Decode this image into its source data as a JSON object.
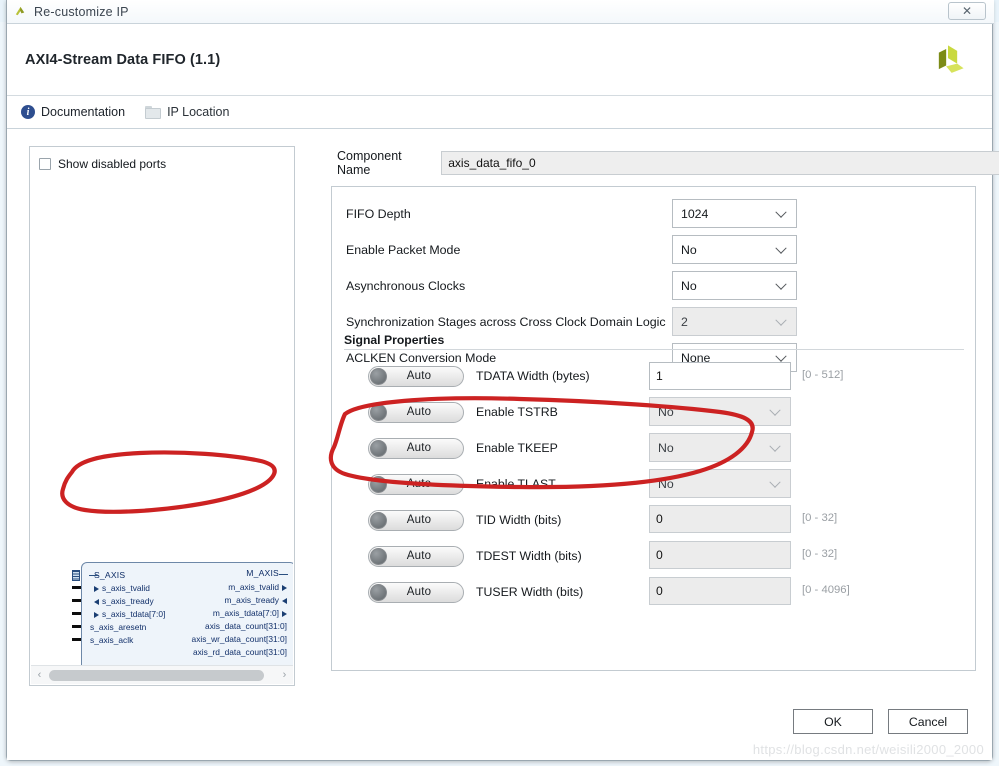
{
  "window": {
    "title": "Re-customize IP",
    "close_label": "✕",
    "app_icon": "xilinx-vivado-icon"
  },
  "header": {
    "ip_title": "AXI4-Stream Data FIFO (1.1)",
    "logo": "xilinx-logo"
  },
  "toolbar": {
    "documentation_label": "Documentation",
    "documentation_icon": "info-icon",
    "ip_location_label": "IP Location",
    "ip_location_icon": "folder-icon"
  },
  "left_panel": {
    "show_disabled_ports_label": "Show disabled ports",
    "show_disabled_ports_checked": false,
    "scroll_left_icon": "‹",
    "scroll_right_icon": "›",
    "diagram": {
      "slave_group": "S_AXIS",
      "master_group": "M_AXIS",
      "slave_signals": [
        {
          "name": "s_axis_tvalid",
          "dir": "in"
        },
        {
          "name": "s_axis_tready",
          "dir": "out"
        },
        {
          "name": "s_axis_tdata[7:0]",
          "dir": "in"
        }
      ],
      "global_signals": [
        "s_axis_aresetn",
        "s_axis_aclk"
      ],
      "master_signals": [
        {
          "name": "m_axis_tvalid",
          "dir": "out"
        },
        {
          "name": "m_axis_tready",
          "dir": "in"
        },
        {
          "name": "m_axis_tdata[7:0]",
          "dir": "out"
        }
      ],
      "count_signals": [
        "axis_data_count[31:0]",
        "axis_wr_data_count[31:0]",
        "axis_rd_data_count[31:0]"
      ]
    }
  },
  "main": {
    "component_name_label": "Component Name",
    "component_name_value": "axis_data_fifo_0",
    "options": [
      {
        "label": "FIFO Depth",
        "value": "1024",
        "disabled": false
      },
      {
        "label": "Enable Packet Mode",
        "value": "No",
        "disabled": false
      },
      {
        "label": "Asynchronous Clocks",
        "value": "No",
        "disabled": false
      },
      {
        "label": "Synchronization Stages across Cross Clock Domain Logic",
        "value": "2",
        "disabled": true
      },
      {
        "label": "ACLKEN Conversion Mode",
        "value": "None",
        "disabled": false
      }
    ],
    "signal_properties": {
      "legend": "Signal Properties",
      "rows": [
        {
          "toggle": "Auto",
          "name": "TDATA Width (bytes)",
          "kind": "text",
          "value": "1",
          "range": "[0 - 512]",
          "disabled": false
        },
        {
          "toggle": "Auto",
          "name": "Enable TSTRB",
          "kind": "select",
          "value": "No",
          "range": "",
          "disabled": true
        },
        {
          "toggle": "Auto",
          "name": "Enable TKEEP",
          "kind": "select",
          "value": "No",
          "range": "",
          "disabled": true
        },
        {
          "toggle": "Auto",
          "name": "Enable TLAST",
          "kind": "select",
          "value": "No",
          "range": "",
          "disabled": true
        },
        {
          "toggle": "Auto",
          "name": "TID Width (bits)",
          "kind": "text",
          "value": "0",
          "range": "[0 - 32]",
          "disabled": true
        },
        {
          "toggle": "Auto",
          "name": "TDEST Width (bits)",
          "kind": "text",
          "value": "0",
          "range": "[0 - 32]",
          "disabled": true
        },
        {
          "toggle": "Auto",
          "name": "TUSER Width (bits)",
          "kind": "text",
          "value": "0",
          "range": "[0 - 4096]",
          "disabled": true
        }
      ]
    }
  },
  "footer": {
    "ok_label": "OK",
    "cancel_label": "Cancel"
  },
  "watermark": "https://blog.csdn.net/weisili2000_2000",
  "colors": {
    "annotation": "#cc2222",
    "accent": "#2e4e8f",
    "block_fill": "#eef4fa",
    "block_stroke": "#6d88a8"
  }
}
